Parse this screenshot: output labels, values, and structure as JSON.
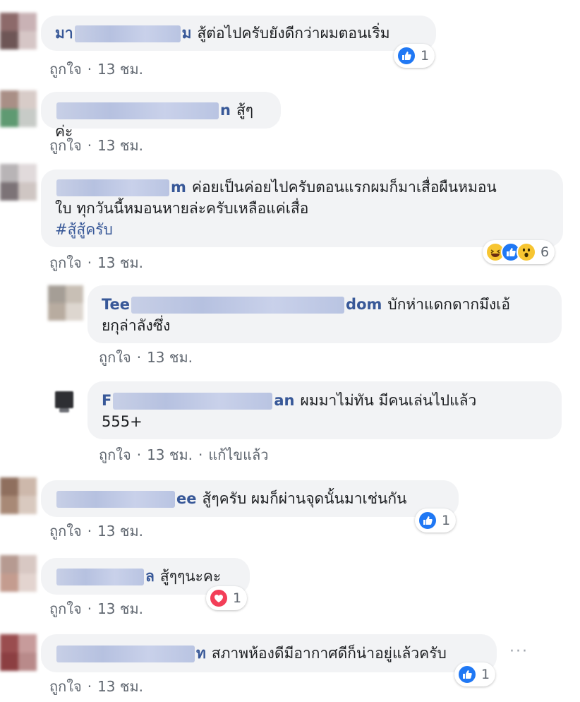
{
  "colors": {
    "bubble": "#f2f3f5",
    "name": "#385898",
    "meta": "#606770",
    "like_blue": "#2078f4",
    "love_red": "#f33e58",
    "haha_yellow": "#f7c531"
  },
  "comments": [
    {
      "name_suffix": "มา",
      "name_tail": "ม",
      "text": "สู้ต่อไปครับยังดีกว่าผมตอนเริ่ม",
      "meta": {
        "like": "ถูกใจ",
        "time": "13 ชม."
      },
      "reaction": {
        "icons": [
          "like-icon"
        ],
        "count": "1"
      }
    },
    {
      "name_tail": "n",
      "text": "สู้ๆค่ะ",
      "meta": {
        "like": "ถูกใจ",
        "time": "13 ชม."
      }
    },
    {
      "name_tail": "m",
      "text_line1": "ค่อยเป็นค่อยไปครับตอนแรกผมก็มาเสื่อผืนหมอน",
      "text_line2": "ใบ ทุกวันนี้หมอนหายล่ะครับเหลือแค่เสื่อ",
      "hashtag": "#สู้สู้ครับ",
      "meta": {
        "like": "ถูกใจ",
        "time": "13 ชม."
      },
      "reaction": {
        "icons": [
          "haha-icon",
          "like-icon",
          "wow-icon"
        ],
        "count": "6"
      }
    },
    {
      "name_head": "Tee",
      "name_tail": "dom",
      "text_line1": "บักห่าแดกดากมึงเอ้",
      "text_line2": "ยกุล่าลังซึ่ง",
      "meta": {
        "like": "ถูกใจ",
        "time": "13 ชม."
      }
    },
    {
      "name_head": "F",
      "name_tail": "an",
      "text_line1": "ผมมาไม่ทัน มีคนเล่นไปแล้ว",
      "text_line2": "555+",
      "meta": {
        "like": "ถูกใจ",
        "time": "13 ชม.",
        "edited": "แก้ไขแล้ว"
      }
    },
    {
      "name_tail": "ee",
      "text": "สู้ๆครับ ผมก็ผ่านจุดนั้นมาเช่นกัน",
      "meta": {
        "like": "ถูกใจ",
        "time": "13 ชม."
      },
      "reaction": {
        "icons": [
          "like-icon"
        ],
        "count": "1"
      }
    },
    {
      "name_tail": "ล",
      "text": "สู้ๆๆนะคะ",
      "meta": {
        "like": "ถูกใจ",
        "time": "13 ชม."
      },
      "reaction": {
        "icons": [
          "heart-icon"
        ],
        "count": "1"
      }
    },
    {
      "name_tail": "ท",
      "text": "สภาพห้องดีมีอากาศดีก็น่าอยู่แล้วครับ",
      "meta": {
        "like": "ถูกใจ",
        "time": "13 ชม."
      },
      "reaction": {
        "icons": [
          "like-icon"
        ],
        "count": "1"
      },
      "more": "···"
    }
  ],
  "separator": "·"
}
